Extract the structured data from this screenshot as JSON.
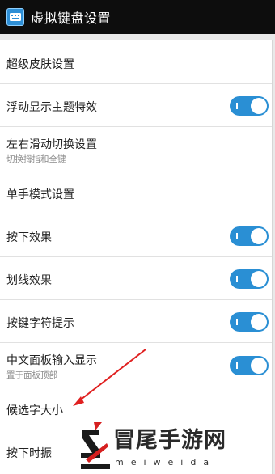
{
  "app": {
    "title": "虚拟键盘设置",
    "icon": "keyboard-app-icon"
  },
  "colors": {
    "titlebar": "#0d0d0d",
    "toggle_on": "#2a8fd4",
    "annotation_arrow": "#e02020"
  },
  "settings": [
    {
      "title": "超级皮肤设置",
      "subtitle": "",
      "toggle": null
    },
    {
      "title": "浮动显示主题特效",
      "subtitle": "",
      "toggle": true
    },
    {
      "title": "左右滑动切换设置",
      "subtitle": "切换拇指和全键",
      "toggle": null
    },
    {
      "title": "单手模式设置",
      "subtitle": "",
      "toggle": null
    },
    {
      "title": "按下效果",
      "subtitle": "",
      "toggle": true
    },
    {
      "title": "划线效果",
      "subtitle": "",
      "toggle": true
    },
    {
      "title": "按键字符提示",
      "subtitle": "",
      "toggle": true
    },
    {
      "title": "中文面板输入显示",
      "subtitle": "置于面板顶部",
      "toggle": true
    },
    {
      "title": "候选字大小",
      "subtitle": "",
      "toggle": null
    },
    {
      "title": "按下时振",
      "subtitle": "",
      "toggle": null
    }
  ],
  "watermark": {
    "main": "冒尾手游网",
    "sub": "meiweida"
  }
}
